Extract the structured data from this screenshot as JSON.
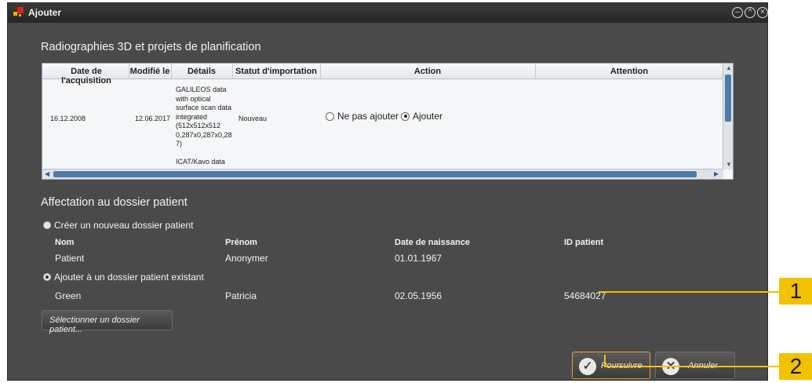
{
  "window": {
    "title": "Ajouter",
    "controls": [
      "minimize",
      "restore",
      "close"
    ]
  },
  "radiographs": {
    "section_title": "Radiographies 3D et projets de planification",
    "columns": [
      "Date de l'acquisition",
      "Modifié le",
      "Détails",
      "Statut d'importation",
      "Action",
      "Attention"
    ],
    "row": {
      "acquisition_date": "16.12.2008",
      "modified_date": "12.06.2017",
      "details_lines": [
        "GALILEOS data",
        "with optical",
        "surface scan data",
        "integrated",
        "(512x512x512",
        "0,287x0,287x0,28",
        "7)"
      ],
      "next_row_partial": "ICAT/Kavo data",
      "import_status": "Nouveau",
      "action_options": [
        "Ne pas ajouter",
        "Ajouter"
      ],
      "action_selected": "Ajouter"
    }
  },
  "patient": {
    "section_title": "Affectation au dossier patient",
    "option_new": "Créer un nouveau dossier patient",
    "option_existing": "Ajouter à un dossier patient existant",
    "selected_option": "existing",
    "headers": {
      "name": "Nom",
      "firstname": "Prénom",
      "birthdate": "Date de naissance",
      "patient_id": "ID patient"
    },
    "new_patient": {
      "name": "Patient",
      "firstname": "Anonymer",
      "birthdate": "01.01.1967"
    },
    "existing_patient": {
      "name": "Green",
      "firstname": "Patricia",
      "birthdate": "02.05.1956",
      "patient_id": "54684027"
    },
    "select_button": "Sélectionner un dossier patient..."
  },
  "buttons": {
    "continue": "Poursuivre",
    "cancel": "Annuler"
  },
  "callouts": [
    "1",
    "2"
  ],
  "colors": {
    "window_bg": "#4a4a4a",
    "scroll_thumb": "#4f7ba9",
    "callout": "#f2c200"
  }
}
